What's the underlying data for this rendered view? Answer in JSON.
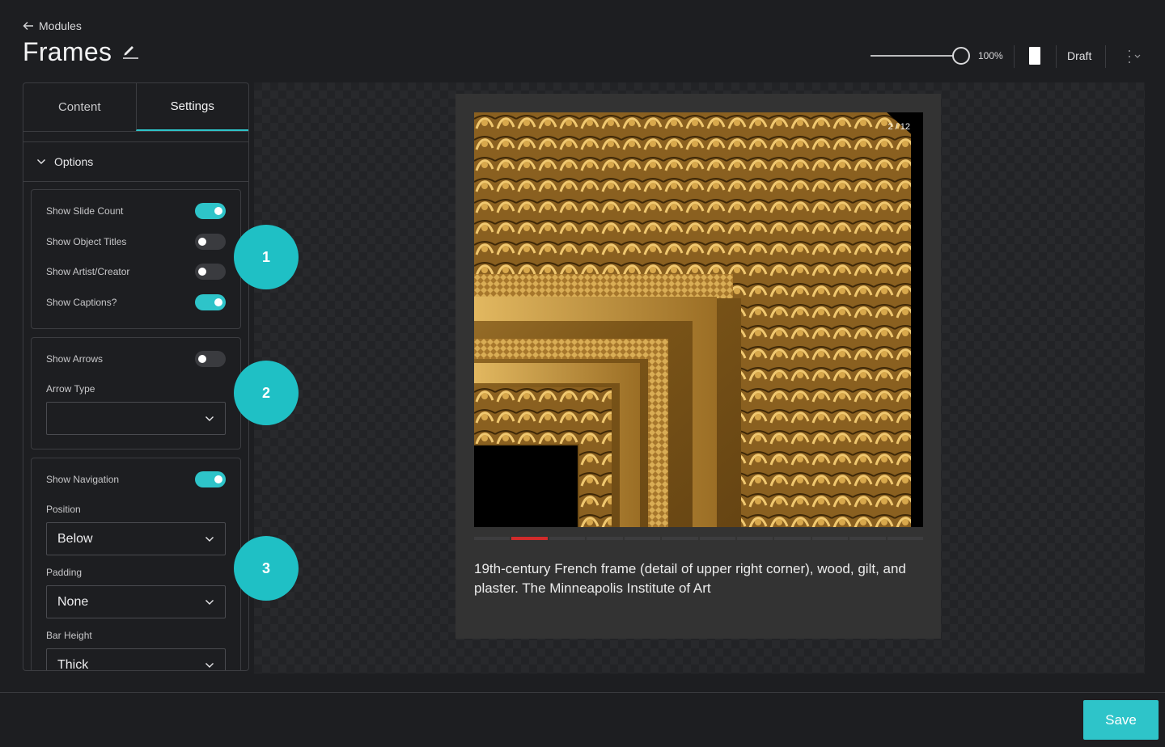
{
  "header": {
    "back_label": "Modules",
    "title": "Frames",
    "zoom_label": "100%",
    "status": "Draft"
  },
  "panel": {
    "tabs": [
      "Content",
      "Settings"
    ],
    "active_tab": "Settings",
    "section_title": "Options",
    "group1": [
      {
        "label": "Show Slide Count",
        "on": true
      },
      {
        "label": "Show Object Titles",
        "on": false
      },
      {
        "label": "Show Artist/Creator",
        "on": false
      },
      {
        "label": "Show Captions?",
        "on": true
      }
    ],
    "group2": {
      "show_arrows_label": "Show Arrows",
      "show_arrows_on": false,
      "arrow_type_label": "Arrow Type",
      "arrow_type_value": ""
    },
    "group3": {
      "show_navigation_label": "Show Navigation",
      "show_navigation_on": true,
      "position_label": "Position",
      "position_value": "Below",
      "padding_label": "Padding",
      "padding_value": "None",
      "bar_height_label": "Bar Height",
      "bar_height_value": "Thick"
    }
  },
  "callouts": [
    "1",
    "2",
    "3"
  ],
  "preview": {
    "slide_count": "2 / 12",
    "current_slide": 2,
    "total_slides": 12,
    "caption": "19th-century French frame (detail of upper right corner), wood, gilt, and plaster. The Minneapolis Institute of Art"
  },
  "footer": {
    "save_label": "Save"
  },
  "colors": {
    "accent": "#2ec4c9",
    "progress_active": "#d12b2b",
    "background": "#1d1e21"
  }
}
